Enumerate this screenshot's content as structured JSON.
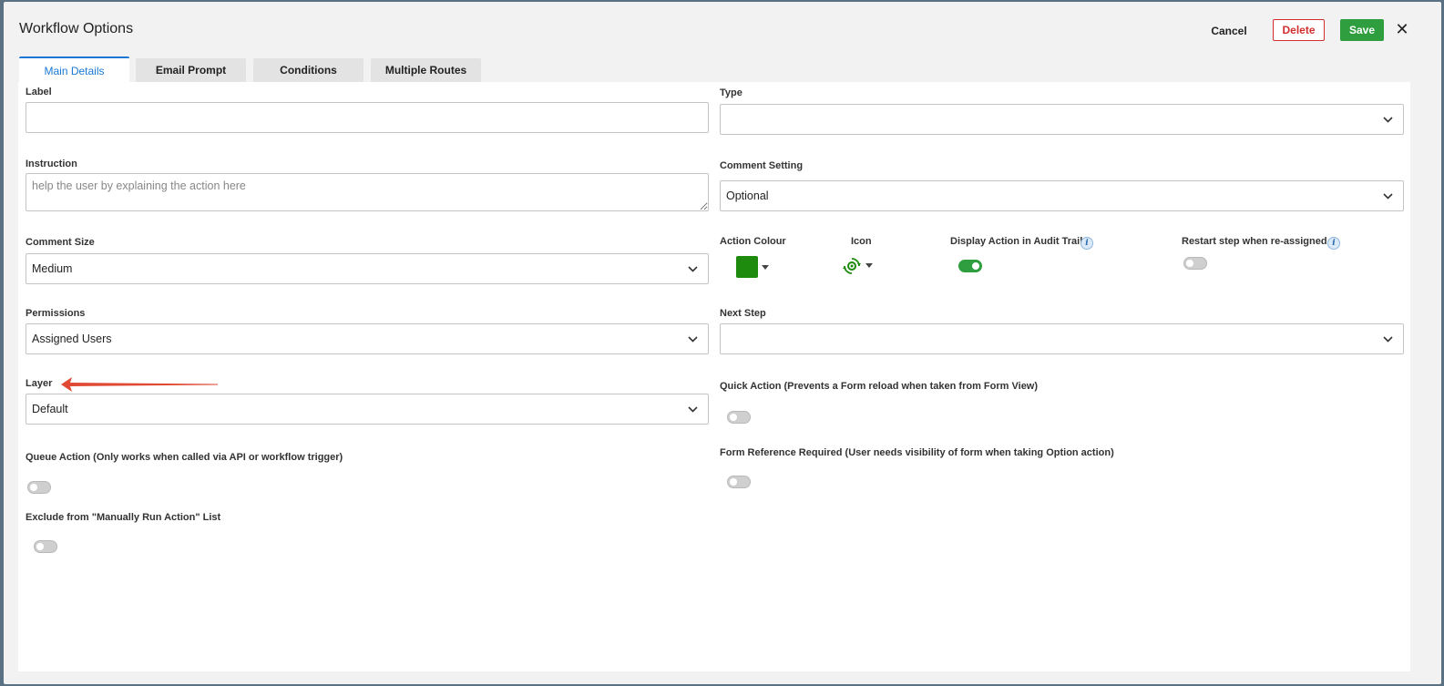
{
  "dialog": {
    "title": "Workflow Options",
    "cancel_label": "Cancel",
    "delete_label": "Delete",
    "save_label": "Save",
    "close_glyph": "✕"
  },
  "tabs": [
    {
      "label": "Main Details",
      "active": true
    },
    {
      "label": "Email Prompt",
      "active": false
    },
    {
      "label": "Conditions",
      "active": false
    },
    {
      "label": "Multiple Routes",
      "active": false
    }
  ],
  "form": {
    "label": {
      "label": "Label",
      "value": ""
    },
    "type": {
      "label": "Type",
      "value": ""
    },
    "instruction": {
      "label": "Instruction",
      "placeholder": "help the user by explaining the action here"
    },
    "comment_setting": {
      "label": "Comment Setting",
      "value": "Optional"
    },
    "comment_size": {
      "label": "Comment Size",
      "value": "Medium"
    },
    "action_colour": {
      "label": "Action Colour",
      "color": "#1e8a0e"
    },
    "icon": {
      "label": "Icon",
      "icon_name": "gear-refresh-icon"
    },
    "display_in_audit": {
      "label": "Display Action in Audit Trail",
      "enabled": true
    },
    "restart_step": {
      "label": "Restart step when re-assigned",
      "enabled": false
    },
    "permissions": {
      "label": "Permissions",
      "value": "Assigned Users"
    },
    "next_step": {
      "label": "Next Step",
      "value": ""
    },
    "layer": {
      "label": "Layer",
      "value": "Default"
    },
    "quick_action": {
      "label": "Quick Action (Prevents a Form reload when taken from Form View)",
      "enabled": false
    },
    "queue_action": {
      "label": "Queue Action (Only works when called via API or workflow trigger)",
      "enabled": false
    },
    "form_reference": {
      "label": "Form Reference Required (User needs visibility of form when taking Option action)",
      "enabled": false
    },
    "exclude_manual": {
      "label": "Exclude from \"Manually Run Action\" List",
      "enabled": false
    }
  },
  "colors": {
    "accent": "#1a78d4",
    "save": "#2e9e3e",
    "delete": "#d32f2f",
    "annotation_arrow": "#e04a35"
  }
}
